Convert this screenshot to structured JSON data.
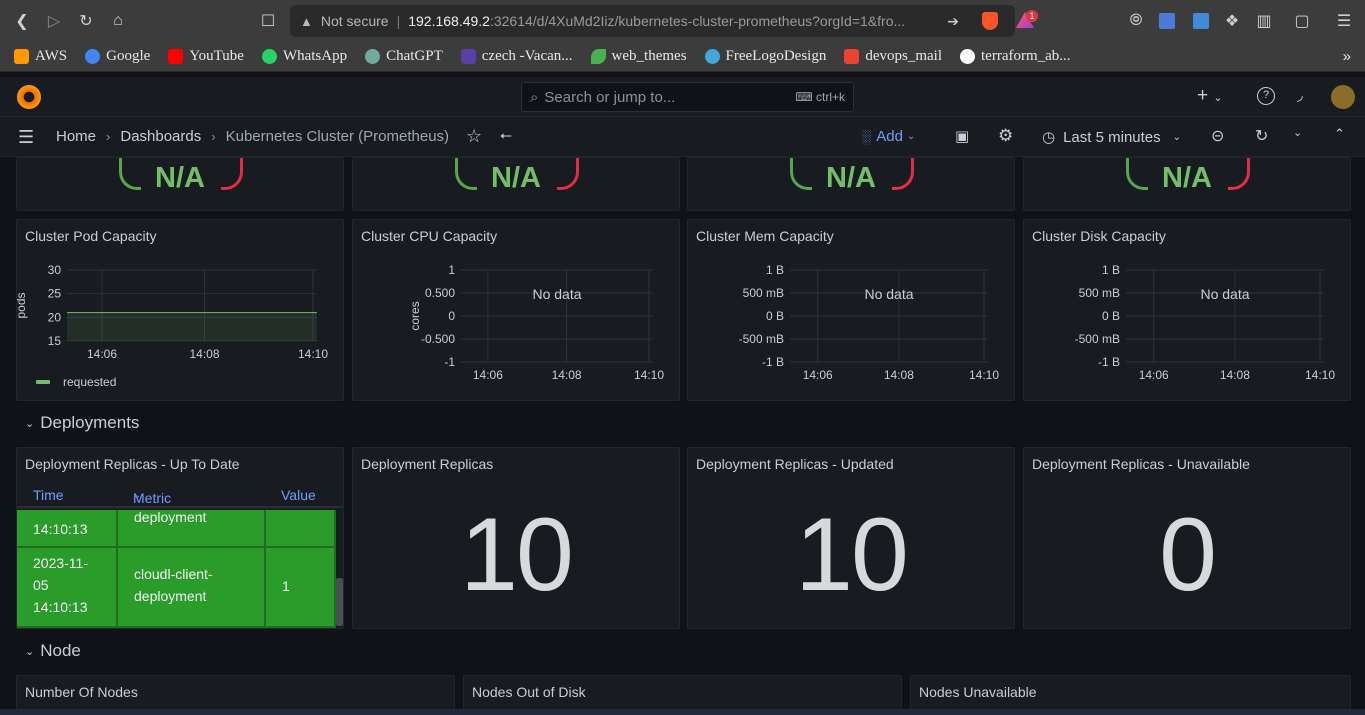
{
  "browser": {
    "url_not_secure": "Not secure",
    "url_host": "192.168.49.2",
    "url_path": ":32614/d/4XuMd2Iiz/kubernetes-cluster-prometheus?orgId=1&fro...",
    "bookmarks": [
      {
        "label": "AWS",
        "color": "#ff9900"
      },
      {
        "label": "Google",
        "color": "#4285f4"
      },
      {
        "label": "YouTube",
        "color": "#ff0000"
      },
      {
        "label": "WhatsApp",
        "color": "#25d366"
      },
      {
        "label": "ChatGPT",
        "color": "#74aa9c"
      },
      {
        "label": "czech -Vacan...",
        "color": "#5b3fa8"
      },
      {
        "label": "web_themes",
        "color": "#4caf50"
      },
      {
        "label": "FreeLogoDesign",
        "color": "#3fa9d8"
      },
      {
        "label": "devops_mail",
        "color": "#ea4335"
      },
      {
        "label": "terraform_ab...",
        "color": "#ffffff"
      }
    ]
  },
  "grafana": {
    "search_placeholder": "Search or jump to...",
    "search_shortcut": "ctrl+k",
    "breadcrumbs": [
      "Home",
      "Dashboards",
      "Kubernetes Cluster (Prometheus)"
    ],
    "add_label": "Add",
    "time_range": "Last 5 minutes"
  },
  "gauges": [
    "N/A",
    "N/A",
    "N/A",
    "N/A"
  ],
  "capacity_panels": {
    "pod": {
      "title": "Cluster Pod Capacity",
      "ylabel": "pods",
      "yticks": [
        "30",
        "25",
        "20",
        "15"
      ],
      "xticks": [
        "14:06",
        "14:08",
        "14:10"
      ],
      "legend": "requested"
    },
    "cpu": {
      "title": "Cluster CPU Capacity",
      "ylabel": "cores",
      "yticks": [
        "1",
        "0.500",
        "0",
        "-0.500",
        "-1"
      ],
      "xticks": [
        "14:06",
        "14:08",
        "14:10"
      ],
      "nodata": "No data"
    },
    "mem": {
      "title": "Cluster Mem Capacity",
      "yticks": [
        "1 B",
        "500 mB",
        "0 B",
        "-500 mB",
        "-1 B"
      ],
      "xticks": [
        "14:06",
        "14:08",
        "14:10"
      ],
      "nodata": "No data"
    },
    "disk": {
      "title": "Cluster Disk Capacity",
      "yticks": [
        "1 B",
        "500 mB",
        "0 B",
        "-500 mB",
        "-1 B"
      ],
      "xticks": [
        "14:06",
        "14:08",
        "14:10"
      ],
      "nodata": "No data"
    }
  },
  "chart_data": {
    "type": "line",
    "title": "Cluster Pod Capacity",
    "ylabel": "pods",
    "ylim": [
      15,
      30
    ],
    "x": [
      "14:05",
      "14:06",
      "14:07",
      "14:08",
      "14:09",
      "14:10"
    ],
    "series": [
      {
        "name": "requested",
        "values": [
          21,
          21,
          21,
          21,
          21,
          21
        ]
      }
    ]
  },
  "rows": {
    "deployments": "Deployments",
    "node": "Node"
  },
  "deploy_table": {
    "title": "Deployment Replicas - Up To Date",
    "headers": [
      "Time",
      "Metric",
      "Value"
    ],
    "row1": {
      "time": "14:10:13",
      "metric": "deployment"
    },
    "row2": {
      "time_a": "2023-11-",
      "time_b": "05",
      "time_c": "14:10:13",
      "metric_a": "cloudl-client-",
      "metric_b": "deployment",
      "value": "1"
    }
  },
  "stats": [
    {
      "title": "Deployment Replicas",
      "value": "10"
    },
    {
      "title": "Deployment Replicas - Updated",
      "value": "10"
    },
    {
      "title": "Deployment Replicas - Unavailable",
      "value": "0"
    }
  ],
  "node_panels": [
    "Number Of Nodes",
    "Nodes Out of Disk",
    "Nodes Unavailable"
  ]
}
